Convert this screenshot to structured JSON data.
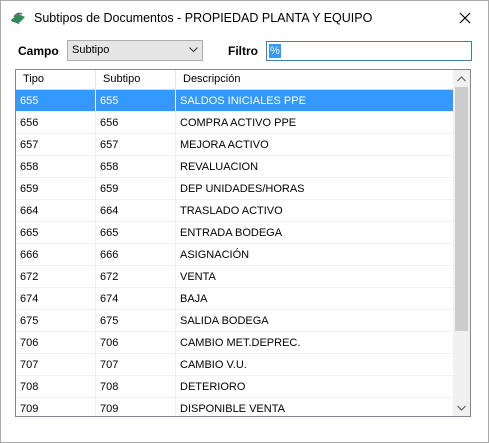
{
  "window": {
    "title": "Subtipos de Documentos - PROPIEDAD PLANTA Y EQUIPO"
  },
  "toolbar": {
    "campo_label": "Campo",
    "campo_value": "Subtipo",
    "filtro_label": "Filtro",
    "filtro_value": "%"
  },
  "table": {
    "columns": [
      "Tipo",
      "Subtipo",
      "Descripción"
    ],
    "selected_row": 0,
    "rows": [
      [
        "655",
        "655",
        "SALDOS INICIALES PPE"
      ],
      [
        "656",
        "656",
        "COMPRA ACTIVO PPE"
      ],
      [
        "657",
        "657",
        "MEJORA ACTIVO"
      ],
      [
        "658",
        "658",
        "REVALUACION"
      ],
      [
        "659",
        "659",
        "DEP UNIDADES/HORAS"
      ],
      [
        "664",
        "664",
        "TRASLADO ACTIVO"
      ],
      [
        "665",
        "665",
        "ENTRADA BODEGA"
      ],
      [
        "666",
        "666",
        "ASIGNACIÓN"
      ],
      [
        "672",
        "672",
        "VENTA"
      ],
      [
        "674",
        "674",
        "BAJA"
      ],
      [
        "675",
        "675",
        "SALIDA BODEGA"
      ],
      [
        "706",
        "706",
        "CAMBIO MET.DEPREC."
      ],
      [
        "707",
        "707",
        "CAMBIO V.U."
      ],
      [
        "708",
        "708",
        "DETERIORO"
      ],
      [
        "709",
        "709",
        "DISPONIBLE VENTA"
      ]
    ]
  },
  "icons": {
    "app": "app-icon",
    "close": "close-icon",
    "dropdown": "chevron-down-icon",
    "scroll_up": "scroll-up-icon",
    "scroll_down": "scroll-down-icon"
  },
  "colors": {
    "selection": "#3399ff",
    "filter_border": "#3c7fb1"
  }
}
